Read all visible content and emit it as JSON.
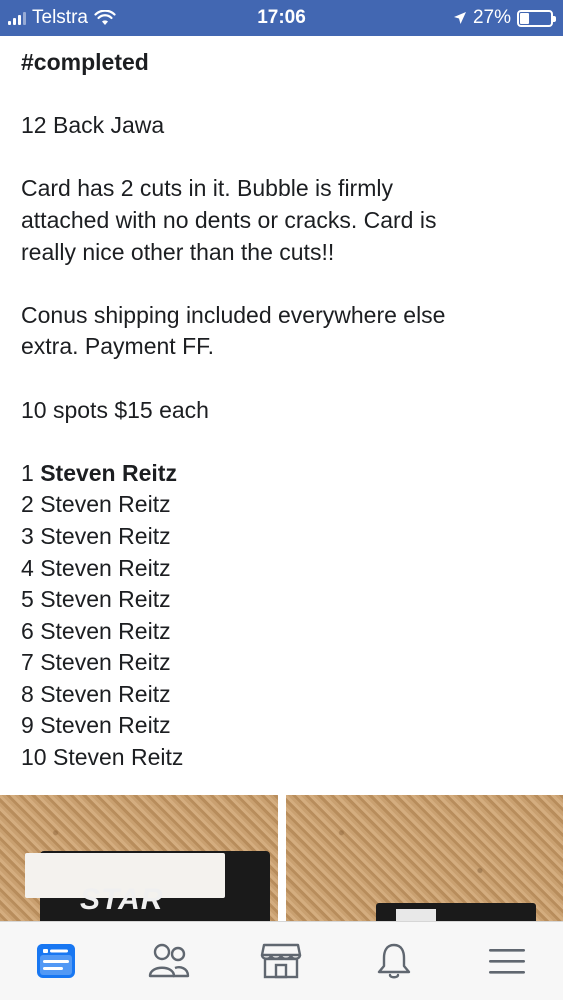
{
  "status_bar": {
    "carrier": "Telstra",
    "time": "17:06",
    "battery": "27%"
  },
  "post": {
    "hashtag": "#completed",
    "title": "12 Back Jawa",
    "description_lines": [
      "Card has 2 cuts in it. Bubble is firmly",
      "attached with no dents or cracks. Card is",
      "really nice other than the cuts!!"
    ],
    "shipping_lines": [
      "Conus shipping included everywhere else",
      "extra. Payment FF."
    ],
    "spots_info": "10 spots $15 each",
    "spots": [
      {
        "number": "1",
        "name": "Steven Reitz"
      },
      {
        "number": "2",
        "name": "Steven Reitz"
      },
      {
        "number": "3",
        "name": "Steven Reitz"
      },
      {
        "number": "4",
        "name": "Steven Reitz"
      },
      {
        "number": "5",
        "name": "Steven Reitz"
      },
      {
        "number": "6",
        "name": "Steven Reitz"
      },
      {
        "number": "7",
        "name": "Steven Reitz"
      },
      {
        "number": "8",
        "name": "Steven Reitz"
      },
      {
        "number": "9",
        "name": "Steven Reitz"
      },
      {
        "number": "10",
        "name": "Steven Reitz"
      }
    ]
  },
  "photos": {
    "card_logo_text": "STAR"
  },
  "bottom_nav": {
    "items": [
      {
        "icon": "news-feed-icon",
        "active": true
      },
      {
        "icon": "friends-icon",
        "active": false
      },
      {
        "icon": "marketplace-icon",
        "active": false
      },
      {
        "icon": "notifications-bell-icon",
        "active": false
      },
      {
        "icon": "menu-icon",
        "active": false
      }
    ]
  },
  "colors": {
    "status_bar_bg": "#4267b2",
    "active_nav": "#1877f2",
    "inactive_nav": "#606770"
  }
}
